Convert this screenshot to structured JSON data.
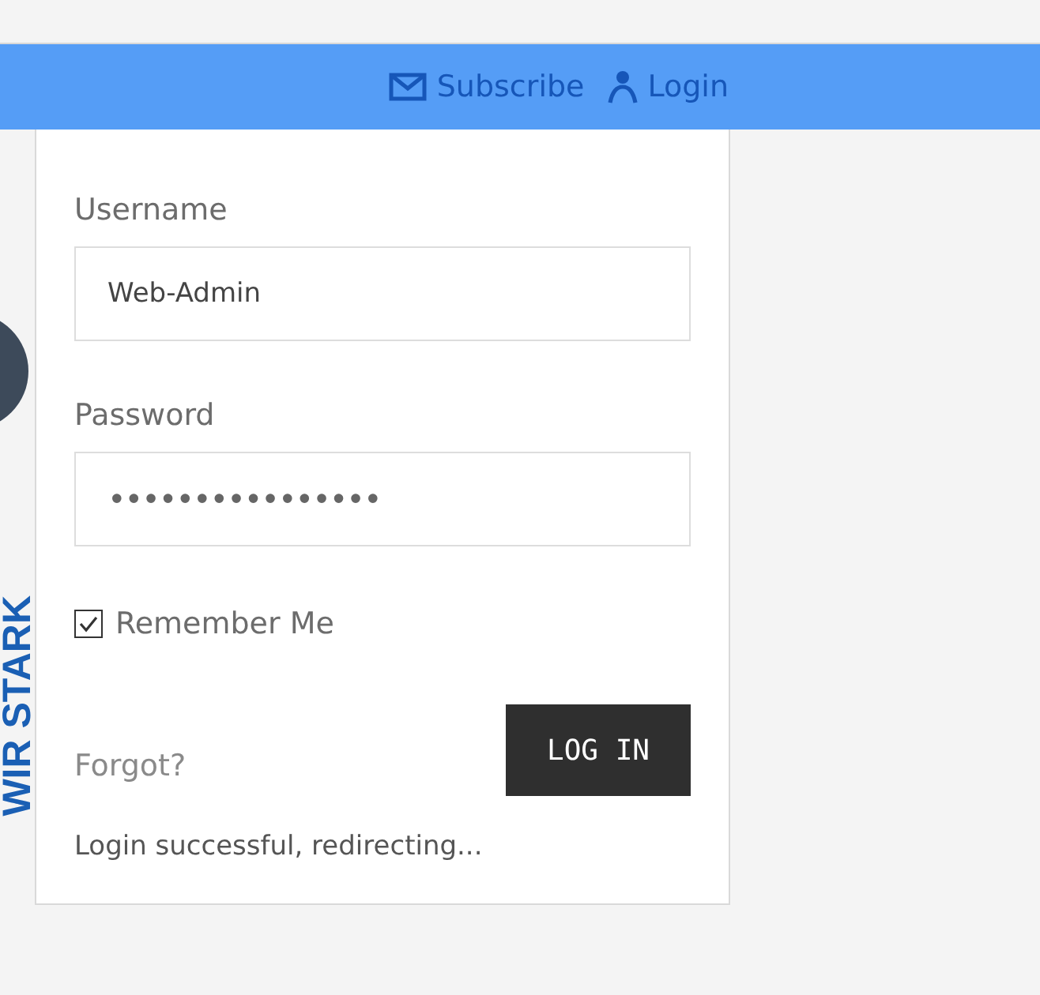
{
  "header": {
    "links": [
      {
        "kind": "mail",
        "label": "Subscribe"
      },
      {
        "kind": "person",
        "label": "Login"
      }
    ]
  },
  "side_banner": {
    "text": "WIR STARK"
  },
  "login_form": {
    "username": {
      "label": "Username",
      "value": "Web-Admin"
    },
    "password": {
      "label": "Password",
      "value": "••••••••••••••••"
    },
    "remember": {
      "label": "Remember Me",
      "checked": true
    },
    "forgot": "Forgot?",
    "submit": "LOG IN",
    "message": "Login successful, redirecting..."
  }
}
